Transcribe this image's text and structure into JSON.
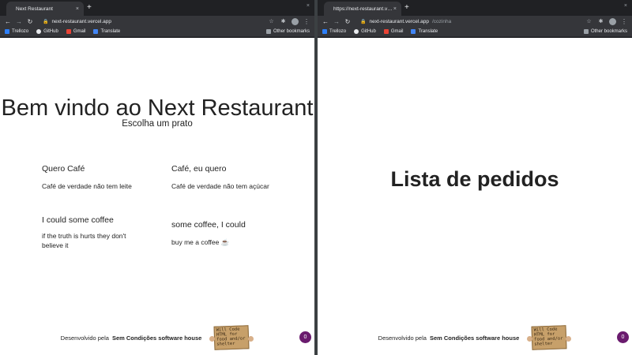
{
  "left_window": {
    "tab_title": "Next Restaurant",
    "tab_close": "×",
    "new_tab": "+",
    "window_close": "×",
    "url_host": "next-restaurant.vercel.app",
    "url_path": "",
    "bookmarks": [
      {
        "label": "Trellozo",
        "color": "#2d7ff9"
      },
      {
        "label": "GitHub",
        "color": "#e8eaed"
      },
      {
        "label": "Gmail",
        "color": "#ea4335"
      },
      {
        "label": "Translate",
        "color": "#4285f4"
      }
    ],
    "other_bookmarks": "Other bookmarks",
    "page": {
      "title": "Bem vindo ao Next Restaurant",
      "subtitle": "Escolha um prato",
      "cards": [
        {
          "title": "Quero Café",
          "desc": "Café de verdade não tem leite"
        },
        {
          "title": "Café, eu quero",
          "desc": "Café de verdade não tem açúcar"
        },
        {
          "title": "I could some coffee",
          "desc": "if the truth is hurts they don't believe it"
        },
        {
          "title": "some coffee, I could",
          "desc": "buy me a coffee ☕"
        }
      ]
    }
  },
  "right_window": {
    "tab_title": "https://next-restaurant.verce",
    "tab_close": "×",
    "new_tab": "+",
    "window_close": "×",
    "url_host": "next-restaurant.vercel.app",
    "url_path": "/cozinha",
    "bookmarks": [
      {
        "label": "Trellozo",
        "color": "#2d7ff9"
      },
      {
        "label": "GitHub",
        "color": "#e8eaed"
      },
      {
        "label": "Gmail",
        "color": "#ea4335"
      },
      {
        "label": "Translate",
        "color": "#4285f4"
      }
    ],
    "other_bookmarks": "Other bookmarks",
    "page": {
      "title": "Lista de pedidos"
    }
  },
  "footer": {
    "prefix": "Desenvolvido pela",
    "company": "Sem Condições software house",
    "sign_text": "Will Code HTML for food and/or shelter",
    "badge_count": "0"
  },
  "icons": {
    "back": "←",
    "forward": "→",
    "reload": "↻",
    "lock": "🔒",
    "star": "☆",
    "extension": "✱",
    "menu": "⋮",
    "folder": "▭"
  },
  "colors": {
    "chrome_dark": "#202124",
    "toolbar": "#35363a",
    "badge": "#6a1b6e"
  }
}
